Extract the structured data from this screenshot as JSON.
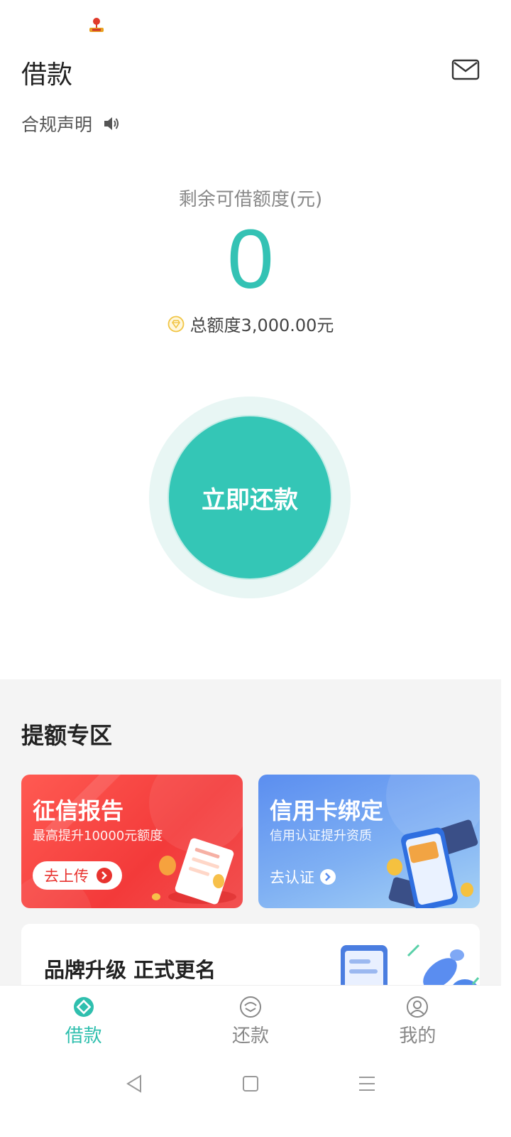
{
  "header": {
    "title": "借款"
  },
  "notice": {
    "label": "合规声明"
  },
  "quota": {
    "label": "剩余可借额度(元)",
    "value": "0",
    "total": "总额度3,000.00元"
  },
  "repay": {
    "label": "立即还款"
  },
  "promo": {
    "title": "提额专区",
    "credit_report": {
      "title": "征信报告",
      "subtitle": "最高提升10000元额度",
      "button": "去上传"
    },
    "card_binding": {
      "title": "信用卡绑定",
      "subtitle": "信用认证提升资质",
      "button": "去认证"
    },
    "brand": {
      "title": "品牌升级 正式更名"
    }
  },
  "tabs": [
    {
      "label": "借款",
      "icon": "loan-icon",
      "active": true
    },
    {
      "label": "还款",
      "icon": "repay-icon",
      "active": false
    },
    {
      "label": "我的",
      "icon": "profile-icon",
      "active": false
    }
  ],
  "colors": {
    "accent": "#34c6b6",
    "red_card": "#f33a3a",
    "blue_card": "#5b8ef0"
  },
  "system_nav": [
    "back-icon",
    "home-icon",
    "menu-icon"
  ]
}
